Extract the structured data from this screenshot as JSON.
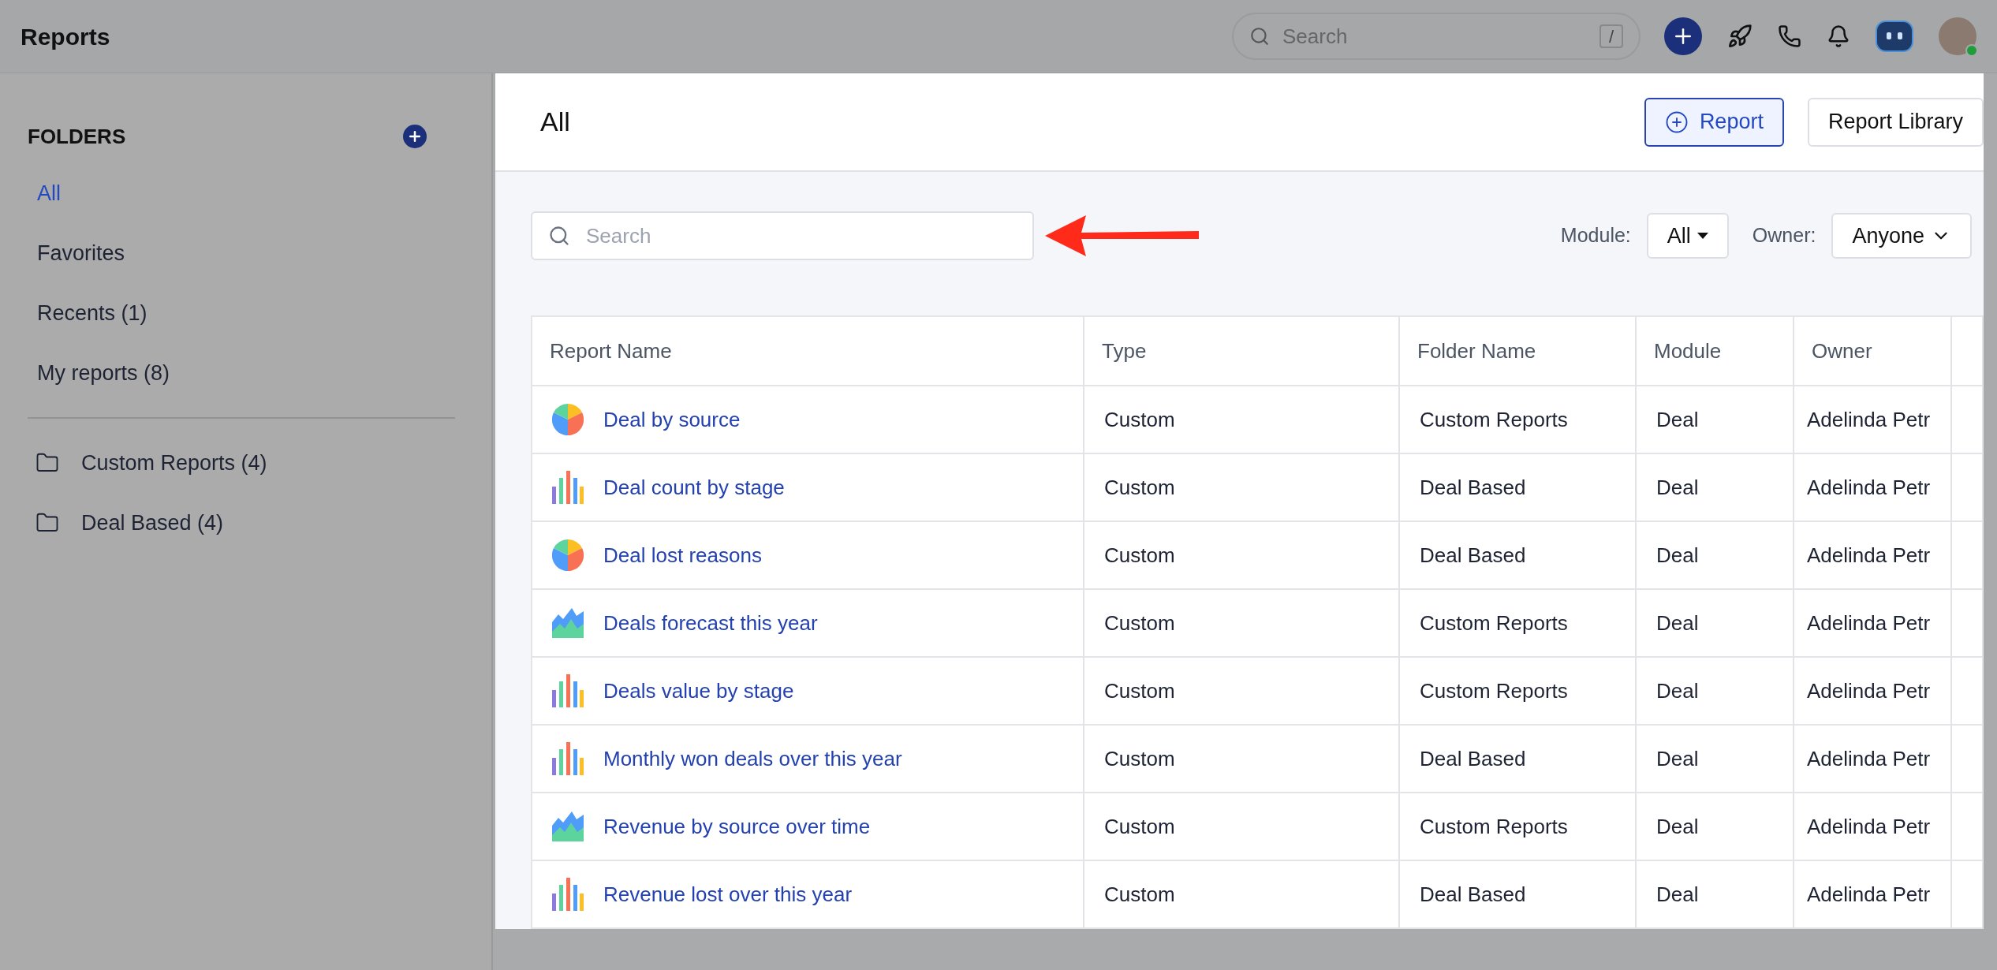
{
  "app": {
    "title": "Reports"
  },
  "top_bar": {
    "search": {
      "placeholder": "Search",
      "shortcut": "/"
    }
  },
  "sidebar": {
    "heading": "FOLDERS",
    "items": [
      {
        "label": "All",
        "selected": true
      },
      {
        "label": "Favorites",
        "selected": false
      },
      {
        "label": "Recents (1)",
        "selected": false
      },
      {
        "label": "My reports (8)",
        "selected": false
      }
    ],
    "folders": [
      {
        "label": "Custom Reports (4)",
        "selected": false
      },
      {
        "label": "Deal Based (4)",
        "selected": false
      }
    ]
  },
  "panel": {
    "title": "All",
    "buttons": [
      {
        "label": "Report",
        "kind": "primary"
      },
      {
        "label": "Report Library",
        "kind": "secondary"
      }
    ],
    "search": {
      "placeholder": "Search"
    },
    "filters": [
      {
        "label": "Module:",
        "value": "All",
        "kind": "caret"
      },
      {
        "label": "Owner:",
        "value": "Anyone",
        "kind": "chevron"
      }
    ]
  },
  "table": {
    "columns": [
      "Report Name",
      "Type",
      "Folder Name",
      "Module",
      "Owner"
    ],
    "rows": [
      {
        "kind": "pie",
        "name": "Deal by source",
        "type": "Custom",
        "folder": "Custom Reports",
        "module": "Deal",
        "owner": "Adelinda Petr"
      },
      {
        "kind": "bar",
        "name": "Deal count by stage",
        "type": "Custom",
        "folder": "Deal Based",
        "module": "Deal",
        "owner": "Adelinda Petr"
      },
      {
        "kind": "pie",
        "name": "Deal lost reasons",
        "type": "Custom",
        "folder": "Deal Based",
        "module": "Deal",
        "owner": "Adelinda Petr"
      },
      {
        "kind": "area",
        "name": "Deals forecast this year",
        "type": "Custom",
        "folder": "Custom Reports",
        "module": "Deal",
        "owner": "Adelinda Petr"
      },
      {
        "kind": "bar",
        "name": "Deals value by stage",
        "type": "Custom",
        "folder": "Custom Reports",
        "module": "Deal",
        "owner": "Adelinda Petr"
      },
      {
        "kind": "bar",
        "name": "Monthly won deals over this year",
        "type": "Custom",
        "folder": "Deal Based",
        "module": "Deal",
        "owner": "Adelinda Petr"
      },
      {
        "kind": "area",
        "name": "Revenue by source over time",
        "type": "Custom",
        "folder": "Custom Reports",
        "module": "Deal",
        "owner": "Adelinda Petr"
      },
      {
        "kind": "bar",
        "name": "Revenue lost over this year",
        "type": "Custom",
        "folder": "Deal Based",
        "module": "Deal",
        "owner": "Adelinda Petr"
      }
    ]
  }
}
